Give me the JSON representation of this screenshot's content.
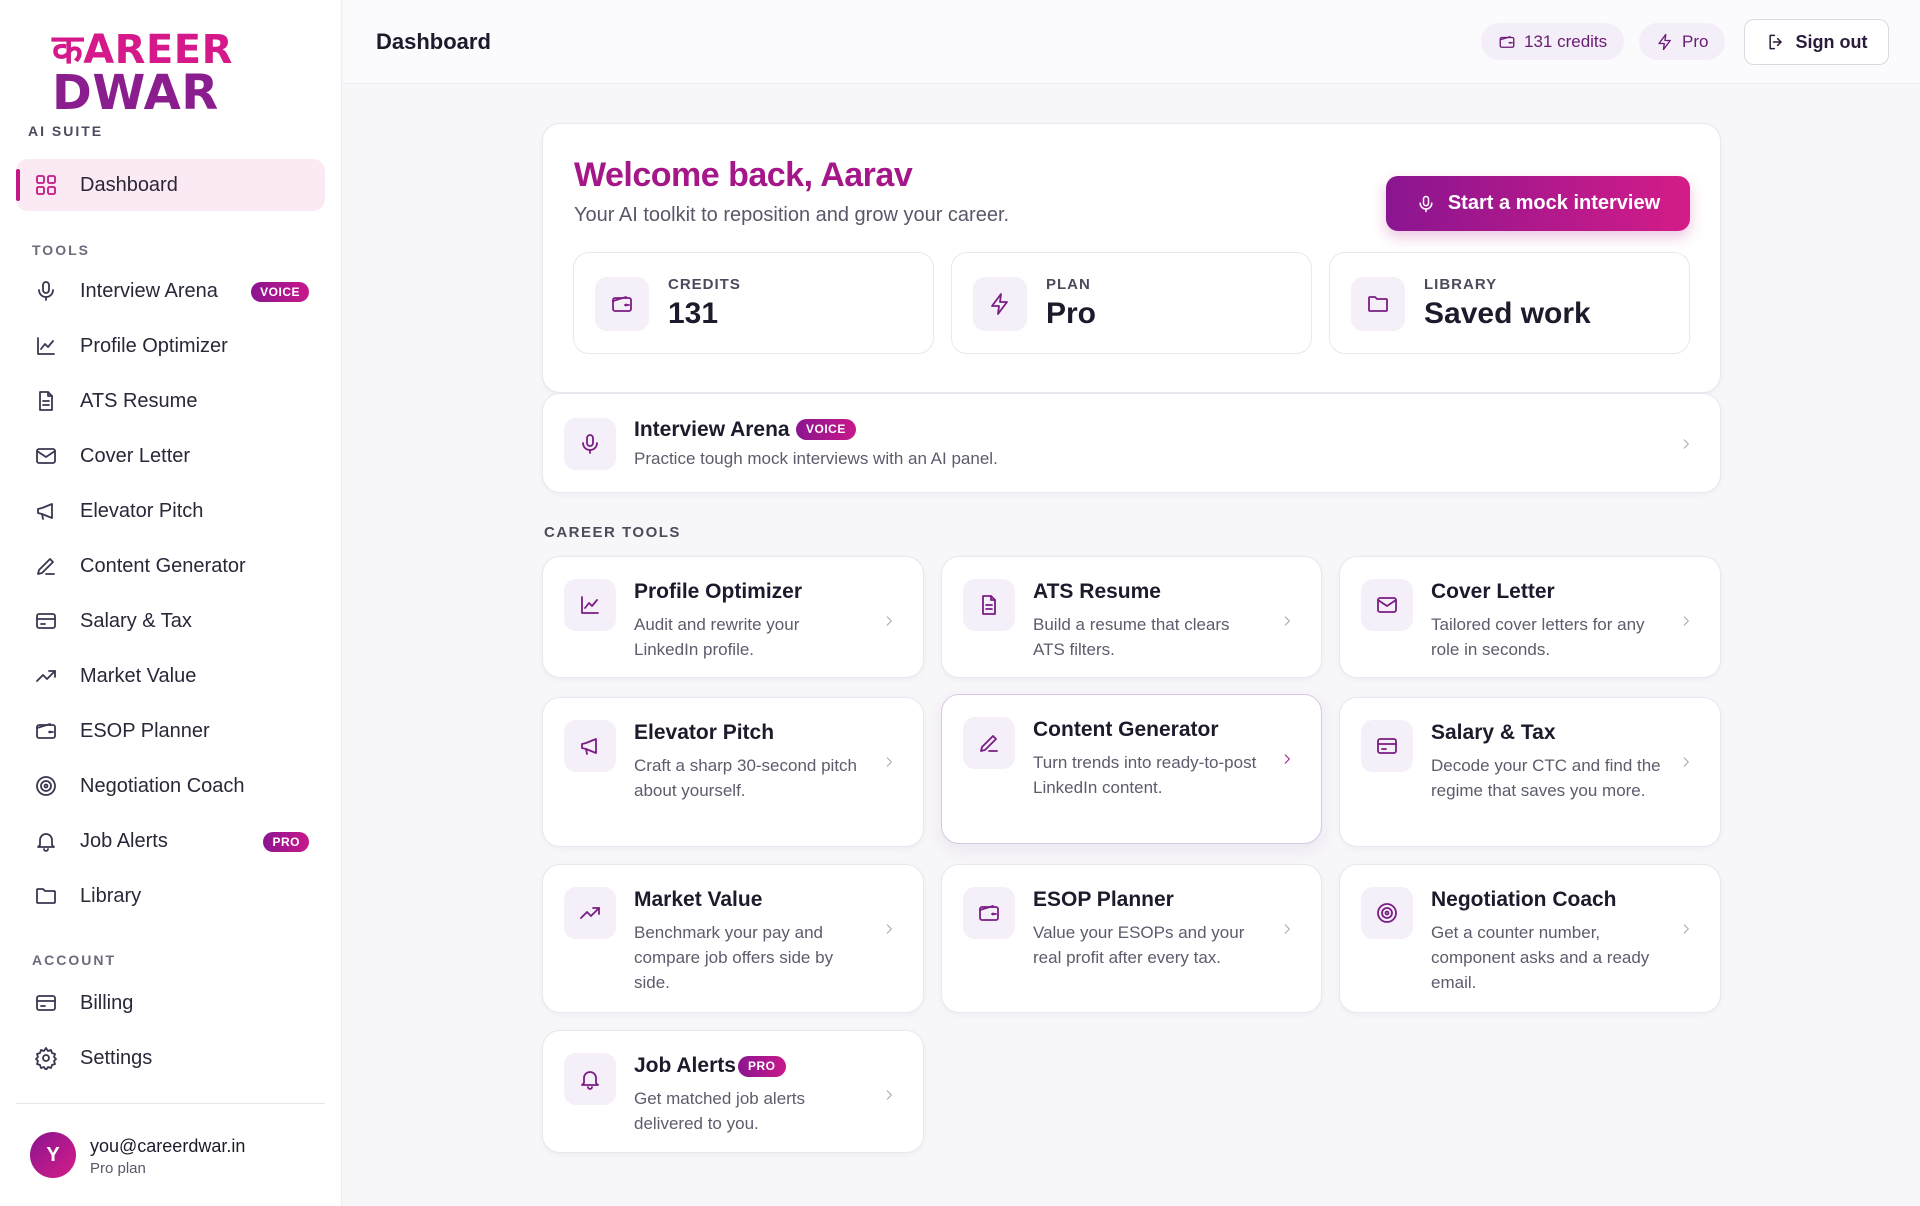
{
  "brand": {
    "line1": "कAREER",
    "line2": "DWAR",
    "suite": "AI SUITE"
  },
  "sidebar": {
    "active": {
      "label": "Dashboard",
      "icon": "grid-icon"
    },
    "tools_title": "TOOLS",
    "tools": [
      {
        "label": "Interview Arena",
        "icon": "mic-icon",
        "badge": "VOICE"
      },
      {
        "label": "Profile Optimizer",
        "icon": "chart-icon"
      },
      {
        "label": "ATS Resume",
        "icon": "file-icon"
      },
      {
        "label": "Cover Letter",
        "icon": "mail-icon"
      },
      {
        "label": "Elevator Pitch",
        "icon": "megaphone-icon"
      },
      {
        "label": "Content Generator",
        "icon": "pen-icon"
      },
      {
        "label": "Salary & Tax",
        "icon": "card-icon"
      },
      {
        "label": "Market Value",
        "icon": "trending-icon"
      },
      {
        "label": "ESOP Planner",
        "icon": "wallet-icon"
      },
      {
        "label": "Negotiation Coach",
        "icon": "target-icon"
      },
      {
        "label": "Job Alerts",
        "icon": "bell-icon",
        "badge": "PRO"
      },
      {
        "label": "Library",
        "icon": "folder-icon"
      }
    ],
    "account_title": "ACCOUNT",
    "account": [
      {
        "label": "Billing",
        "icon": "card-icon"
      },
      {
        "label": "Settings",
        "icon": "gear-icon"
      }
    ],
    "user": {
      "initial": "Y",
      "email": "you@careerdwar.in",
      "plan": "Pro plan"
    }
  },
  "topbar": {
    "title": "Dashboard",
    "credits": "131 credits",
    "plan": "Pro",
    "signout": "Sign out"
  },
  "welcome": {
    "title": "Welcome back, Aarav",
    "subtitle": "Your AI toolkit to reposition and grow your career.",
    "cta": "Start a mock interview",
    "stats": [
      {
        "label": "CREDITS",
        "value": "131",
        "icon": "wallet-icon"
      },
      {
        "label": "PLAN",
        "value": "Pro",
        "icon": "bolt-icon"
      },
      {
        "label": "LIBRARY",
        "value": "Saved work",
        "icon": "folder-icon"
      }
    ]
  },
  "arena": {
    "title": "Interview Arena",
    "badge": "VOICE",
    "desc": "Practice tough mock interviews with an AI panel."
  },
  "career_tools": {
    "title": "CAREER TOOLS",
    "cards": [
      {
        "title": "Profile Optimizer",
        "desc": "Audit and rewrite your LinkedIn profile.",
        "icon": "chart-icon"
      },
      {
        "title": "ATS Resume",
        "desc": "Build a resume that clears ATS filters.",
        "icon": "file-icon"
      },
      {
        "title": "Cover Letter",
        "desc": "Tailored cover letters for any role in seconds.",
        "icon": "mail-icon"
      },
      {
        "title": "Elevator Pitch",
        "desc": "Craft a sharp 30-second pitch about yourself.",
        "icon": "megaphone-icon"
      },
      {
        "title": "Content Generator",
        "desc": "Turn trends into ready-to-post LinkedIn content.",
        "icon": "pen-icon"
      },
      {
        "title": "Salary & Tax",
        "desc": "Decode your CTC and find the regime that saves you more.",
        "icon": "card-icon"
      },
      {
        "title": "Market Value",
        "desc": "Benchmark your pay and compare job offers side by side.",
        "icon": "trending-icon"
      },
      {
        "title": "ESOP Planner",
        "desc": "Value your ESOPs and your real profit after every tax.",
        "icon": "wallet-icon"
      },
      {
        "title": "Negotiation Coach",
        "desc": "Get a counter number, component asks and a ready email.",
        "icon": "target-icon"
      },
      {
        "title": "Job Alerts",
        "desc": "Get matched job alerts delivered to you.",
        "icon": "bell-icon",
        "badge": "PRO"
      }
    ]
  }
}
